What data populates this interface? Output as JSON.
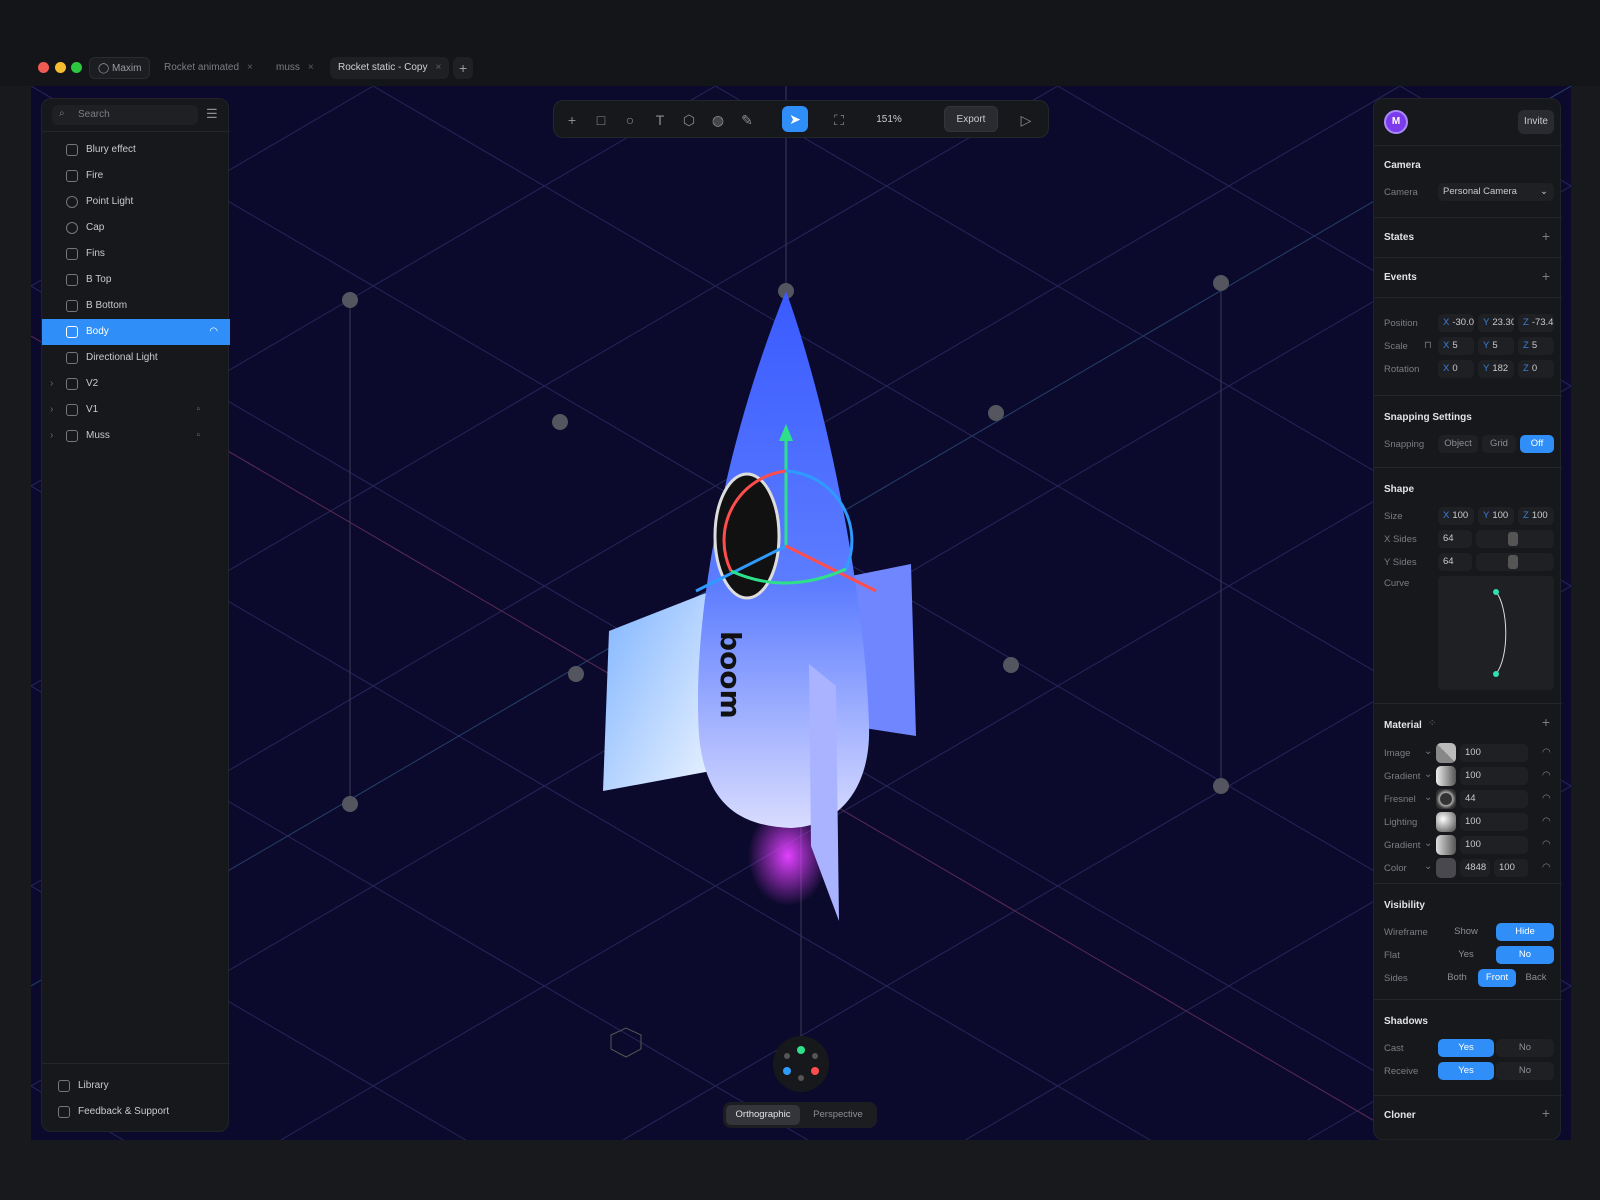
{
  "titlebar": {
    "user": "Maxim",
    "tabs": [
      {
        "label": "Rocket animated"
      },
      {
        "label": "muss"
      },
      {
        "label": "Rocket static - Copy",
        "active": true
      }
    ],
    "close": "×",
    "new_tab": "+"
  },
  "layers": {
    "search_placeholder": "Search",
    "items": [
      {
        "label": "Blury effect",
        "icon": "cylinder-icon"
      },
      {
        "label": "Fire",
        "icon": "cylinder-icon"
      },
      {
        "label": "Point Light",
        "icon": "bulb-icon"
      },
      {
        "label": "Cap",
        "icon": "circle-icon"
      },
      {
        "label": "Fins",
        "icon": "path-icon"
      },
      {
        "label": "B Top",
        "icon": "cylinder-icon"
      },
      {
        "label": "B Bottom",
        "icon": "cylinder-icon"
      },
      {
        "label": "Body",
        "icon": "cylinder-icon",
        "selected": true
      },
      {
        "label": "Directional Light",
        "icon": "light-icon"
      },
      {
        "label": "V2",
        "icon": "group-icon"
      },
      {
        "label": "V1",
        "icon": "group-icon"
      },
      {
        "label": "Muss",
        "icon": "group-icon"
      }
    ],
    "footer": [
      {
        "label": "Library"
      },
      {
        "label": "Feedback & Support"
      }
    ]
  },
  "toolbar": {
    "zoom": "151%",
    "export": "Export"
  },
  "viewport": {
    "brand_text": "boom",
    "views": [
      "Orthographic",
      "Perspective"
    ],
    "active_view": "Orthographic"
  },
  "inspector": {
    "avatar": "M",
    "invite": "Invite",
    "camera": {
      "title": "Camera",
      "label": "Camera",
      "value": "Personal Camera"
    },
    "states": "States",
    "events": "Events",
    "transform": {
      "position": {
        "label": "Position",
        "x": "-30.0",
        "y": "23.30",
        "z": "-73.4"
      },
      "scale": {
        "label": "Scale",
        "x": "5",
        "y": "5",
        "z": "5"
      },
      "rotation": {
        "label": "Rotation",
        "x": "0",
        "y": "182",
        "z": "0"
      }
    },
    "axis": {
      "x": "X",
      "y": "Y",
      "z": "Z"
    },
    "snapping": {
      "title": "Snapping Settings",
      "label": "Snapping",
      "options": [
        "Object",
        "Grid",
        "Off"
      ],
      "active": "Off"
    },
    "shape": {
      "title": "Shape",
      "size_label": "Size",
      "size": {
        "x": "100",
        "y": "100",
        "z": "100"
      },
      "xsides_label": "X Sides",
      "xsides": "64",
      "ysides_label": "Y Sides",
      "ysides": "64",
      "curve_label": "Curve"
    },
    "material": {
      "title": "Material",
      "layers": [
        {
          "label": "Image",
          "value": "100"
        },
        {
          "label": "Gradient",
          "value": "100"
        },
        {
          "label": "Fresnel",
          "value": "44"
        },
        {
          "label": "Lighting",
          "value": "100"
        },
        {
          "label": "Gradient",
          "value": "100"
        },
        {
          "label": "Color",
          "value": "4848",
          "opacity": "100"
        }
      ]
    },
    "visibility": {
      "title": "Visibility",
      "wireframe_label": "Wireframe",
      "wireframe": [
        "Show",
        "Hide"
      ],
      "flat_label": "Flat",
      "flat": [
        "Yes",
        "No"
      ],
      "sides_label": "Sides",
      "sides": [
        "Both",
        "Front",
        "Back"
      ]
    },
    "shadows": {
      "title": "Shadows",
      "cast_label": "Cast",
      "receive_label": "Receive",
      "options": [
        "Yes",
        "No"
      ]
    },
    "cloner": "Cloner"
  },
  "colors": {
    "accent": "#2f8ef7",
    "canvas": "#0c0a2c",
    "panel": "#17181b"
  }
}
